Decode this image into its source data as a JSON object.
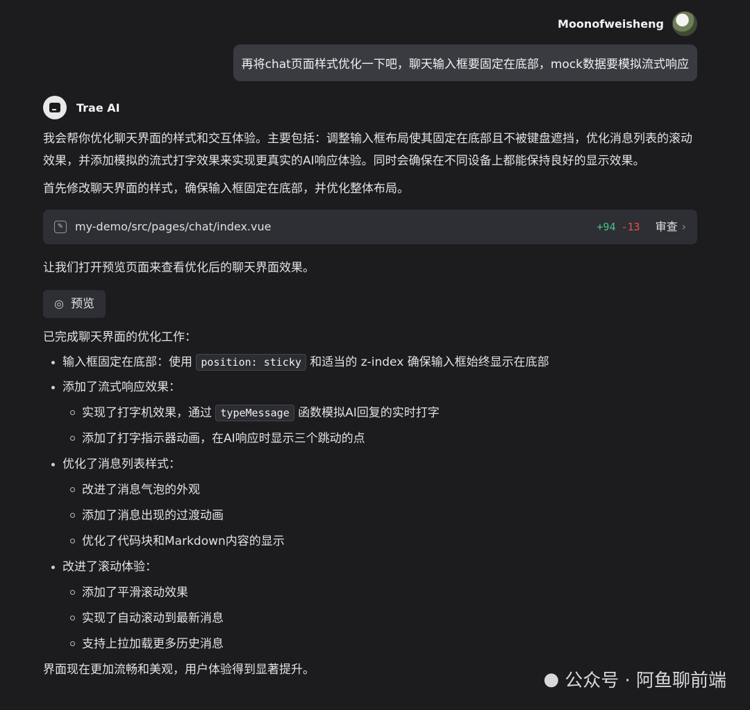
{
  "user": {
    "name": "Moonofweisheng",
    "message": "再将chat页面样式优化一下吧，聊天输入框要固定在底部，mock数据要模拟流式响应"
  },
  "ai": {
    "name": "Trae AI",
    "intro": "我会帮你优化聊天界面的样式和交互体验。主要包括：调整输入框布局使其固定在底部且不被键盘遮挡，优化消息列表的滚动效果，并添加模拟的流式打字效果来实现更真实的AI响应体验。同时会确保在不同设备上都能保持良好的显示效果。",
    "step1": "首先修改聊天界面的样式，确保输入框固定在底部，并优化整体布局。",
    "file": {
      "path": "my-demo/src/pages/chat/index.vue",
      "added": "+94",
      "removed": "-13",
      "review_label": "审查"
    },
    "step2": "让我们打开预览页面来查看优化后的聊天界面效果。",
    "preview_label": "预览",
    "summary_intro": "已完成聊天界面的优化工作：",
    "bullets": {
      "b1_pre": "输入框固定在底部：使用 ",
      "b1_code": "position: sticky",
      "b1_post": " 和适当的 z-index 确保输入框始终显示在底部",
      "b2": "添加了流式响应效果：",
      "b2_1_pre": "实现了打字机效果，通过 ",
      "b2_1_code": "typeMessage",
      "b2_1_post": " 函数模拟AI回复的实时打字",
      "b2_2": "添加了打字指示器动画，在AI响应时显示三个跳动的点",
      "b3": "优化了消息列表样式：",
      "b3_1": "改进了消息气泡的外观",
      "b3_2": "添加了消息出现的过渡动画",
      "b3_3": "优化了代码块和Markdown内容的显示",
      "b4": "改进了滚动体验：",
      "b4_1": "添加了平滑滚动效果",
      "b4_2": "实现了自动滚动到最新消息",
      "b4_3": "支持上拉加载更多历史消息"
    },
    "closing": "界面现在更加流畅和美观，用户体验得到显著提升。"
  },
  "watermark": "公众号 · 阿鱼聊前端",
  "colors": {
    "background": "#1c1c1f",
    "added": "#4cc38a",
    "removed": "#e5534b"
  },
  "icons": [
    "pencil-icon",
    "chevron-right-icon",
    "eye-icon",
    "wechat-icon"
  ]
}
